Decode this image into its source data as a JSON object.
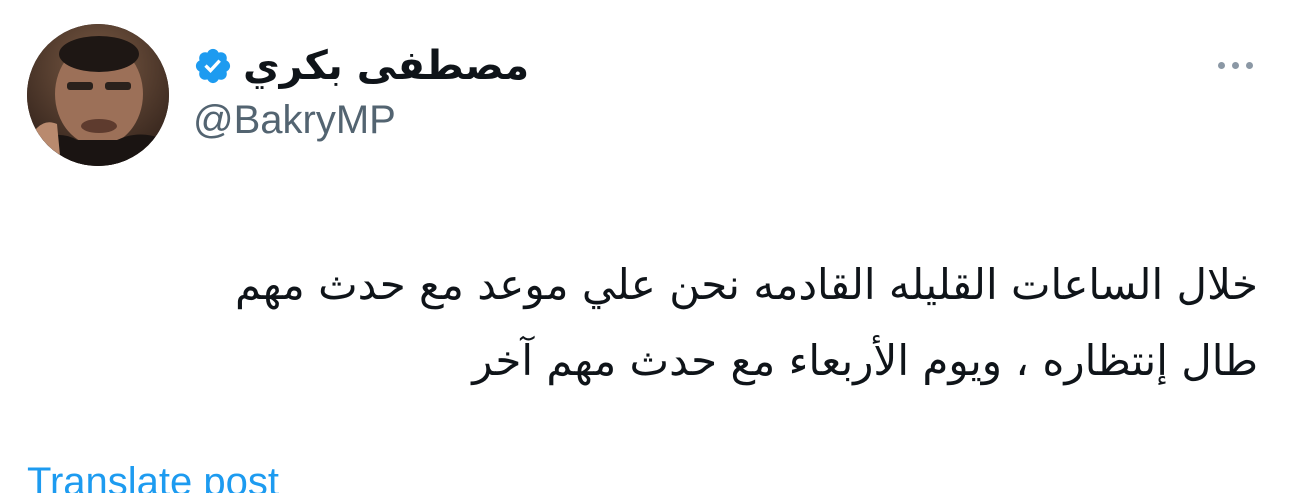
{
  "post": {
    "author": {
      "display_name": "مصطفى بكري",
      "handle": "@BakryMP",
      "verified_icon": "verified-badge-icon",
      "avatar_icon": "avatar-photo"
    },
    "more_icon": "more-options-icon",
    "text": "خلال الساعات القليله القادمه نحن علي موعد مع حدث مهم\nطال إنتظاره ، ويوم الأربعاء مع حدث مهم آخر",
    "translate_label": "Translate post"
  },
  "colors": {
    "text": "#0f1419",
    "secondary": "#536471",
    "accent": "#1d9bf0"
  }
}
